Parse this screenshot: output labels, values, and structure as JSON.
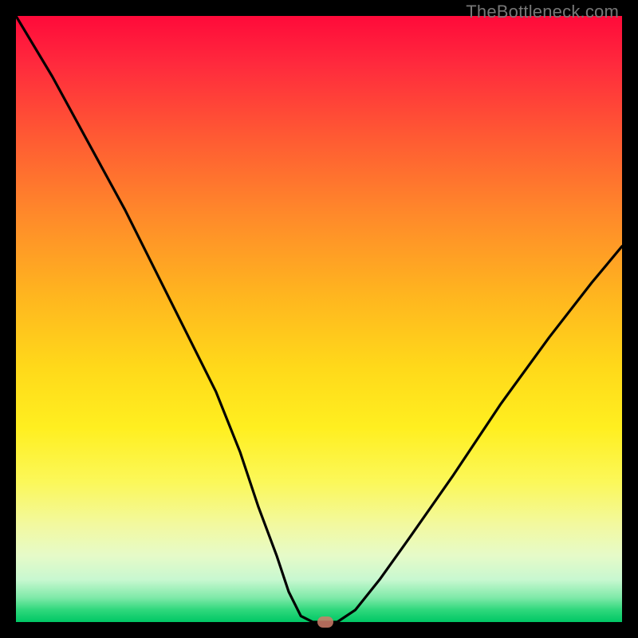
{
  "watermark": "TheBottleneck.com",
  "colors": {
    "frame": "#000000",
    "curve": "#000000",
    "dot": "#d07c6a",
    "gradient_top": "#ff0a3a",
    "gradient_bottom": "#00c765"
  },
  "chart_data": {
    "type": "line",
    "title": "",
    "xlabel": "",
    "ylabel": "",
    "xlim": [
      0,
      100
    ],
    "ylim": [
      0,
      100
    ],
    "grid": false,
    "series": [
      {
        "name": "bottleneck-curve",
        "x": [
          0,
          6,
          12,
          18,
          23,
          28,
          33,
          37,
          40,
          43,
          45,
          47,
          49,
          53,
          56,
          60,
          65,
          72,
          80,
          88,
          95,
          100
        ],
        "y": [
          100,
          90,
          79,
          68,
          58,
          48,
          38,
          28,
          19,
          11,
          5,
          1,
          0,
          0,
          2,
          7,
          14,
          24,
          36,
          47,
          56,
          62
        ]
      }
    ],
    "annotations": [
      {
        "name": "min-point-dot",
        "x": 51,
        "y": 0
      }
    ]
  }
}
